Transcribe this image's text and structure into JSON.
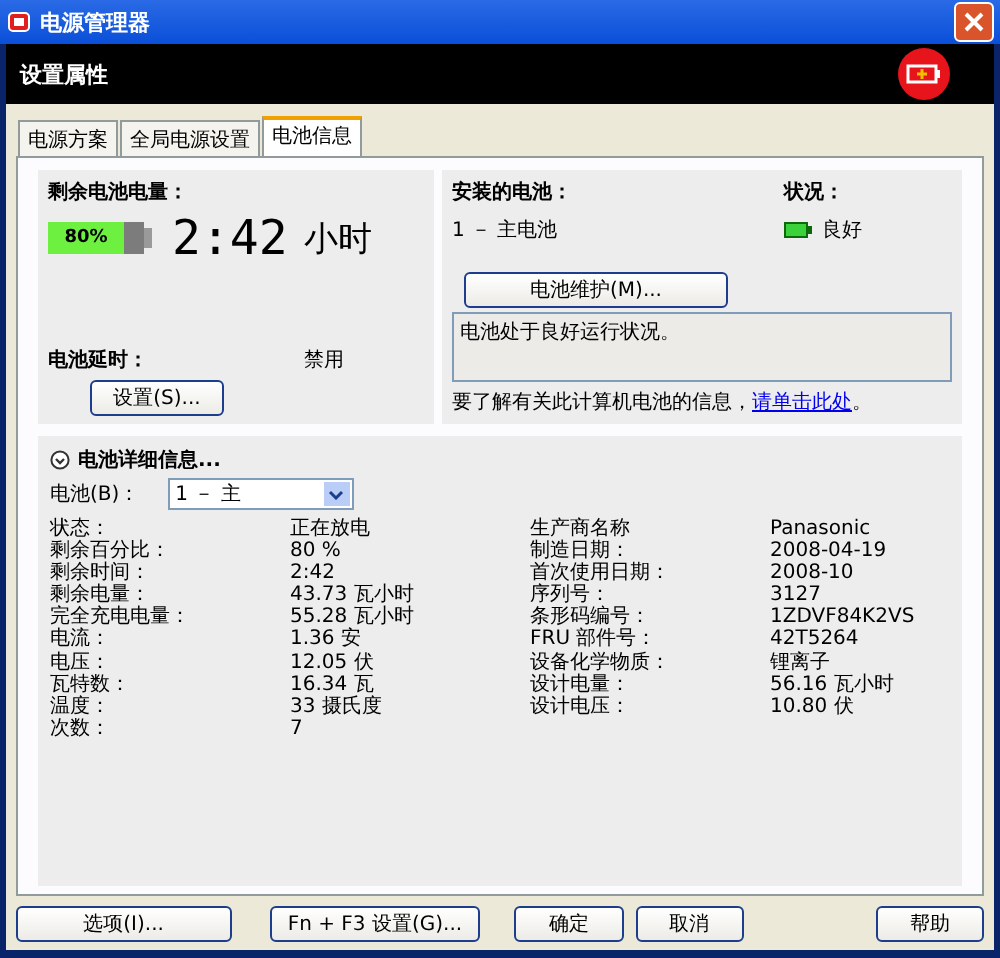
{
  "window": {
    "title": "电源管理器"
  },
  "header": {
    "title": "设置属性"
  },
  "tabs": [
    {
      "label": "电源方案",
      "selected": false
    },
    {
      "label": "全局电源设置",
      "selected": false
    },
    {
      "label": "电池信息",
      "selected": true
    }
  ],
  "battery_charge": {
    "label": "剩余电池电量：",
    "percent": "80%",
    "level": 0.8,
    "time": "2:42",
    "time_unit": "小时"
  },
  "battery_delay": {
    "label": "电池延时：",
    "value": "禁用",
    "button": "设置(S)..."
  },
  "installed": {
    "label": "安装的电池：",
    "battery": "1 － 主电池",
    "status_label": "状况：",
    "status": "良好",
    "maintenance_button": "电池维护(M)...",
    "message": "电池处于良好运行状况。",
    "info_text": "要了解有关此计算机电池的信息，",
    "info_link": "请单击此处",
    "info_end": "。"
  },
  "details": {
    "expanded": true,
    "title": "电池详细信息...",
    "battery_label": "电池(B)：",
    "battery_value": "1 － 主",
    "left": [
      {
        "label": "状态：",
        "value": "正在放电"
      },
      {
        "label": "剩余百分比：",
        "value": "80 %"
      },
      {
        "label": "剩余时间：",
        "value": "2:42"
      },
      {
        "label": "剩余电量：",
        "value": "43.73 瓦小时"
      },
      {
        "label": "完全充电电量：",
        "value": "55.28 瓦小时"
      },
      {
        "label": "电流：",
        "value": "1.36 安"
      },
      {
        "label": "电压：",
        "value": "12.05 伏"
      },
      {
        "label": "瓦特数：",
        "value": "16.34 瓦"
      },
      {
        "label": "温度：",
        "value": "33 摄氏度"
      },
      {
        "label": "次数：",
        "value": "7"
      }
    ],
    "right": [
      {
        "label": "生产商名称",
        "value": "Panasonic"
      },
      {
        "label": "制造日期：",
        "value": "2008-04-19"
      },
      {
        "label": "首次使用日期：",
        "value": "2008-10"
      },
      {
        "label": "序列号：",
        "value": "3127"
      },
      {
        "label": "条形码编号：",
        "value": "1ZDVF84K2VS"
      },
      {
        "label": "FRU 部件号：",
        "value": "42T5264"
      },
      {
        "label": "设备化学物质：",
        "value": "锂离子"
      },
      {
        "label": "设计电量：",
        "value": "56.16 瓦小时"
      },
      {
        "label": "设计电压：",
        "value": "10.80 伏"
      }
    ]
  },
  "buttons": [
    {
      "label": "选项(I)..."
    },
    {
      "label": "Fn + F3 设置(G)..."
    },
    {
      "label": "确定"
    },
    {
      "label": "取消"
    },
    {
      "label": "帮助"
    }
  ]
}
